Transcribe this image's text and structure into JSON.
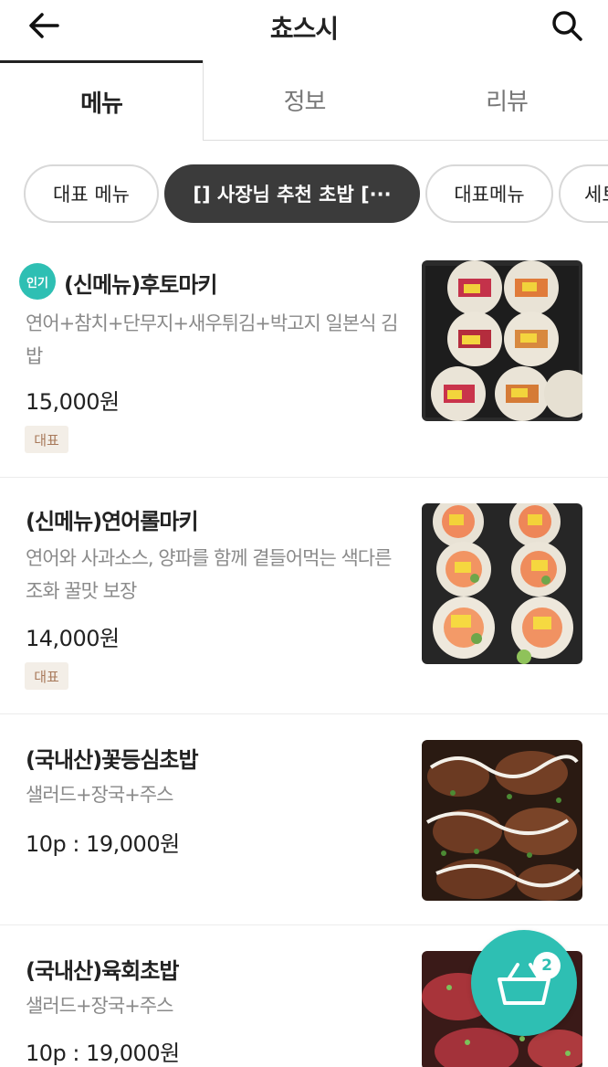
{
  "header": {
    "title": "쵸스시",
    "back_icon": "arrow-left-icon",
    "search_icon": "search-icon"
  },
  "tabs": [
    {
      "label": "메뉴",
      "active": true
    },
    {
      "label": "정보",
      "active": false
    },
    {
      "label": "리뷰",
      "active": false
    }
  ],
  "categories": [
    {
      "label": "대표 메뉴",
      "active": false
    },
    {
      "label": "[] 사장님 추천 초밥 [···",
      "active": true
    },
    {
      "label": "대표메뉴",
      "active": false
    },
    {
      "label": "세트",
      "active": false
    }
  ],
  "menu_items": [
    {
      "popular_badge": "인기",
      "name": "(신메뉴)후토마키",
      "description": "연어+참치+단무지+새우튀김+박고지 일본식 김밥",
      "price": "15,000원",
      "tag": "대표",
      "image": "futomaki-photo"
    },
    {
      "name": "(신메뉴)연어롤마키",
      "description": "연어와 사과소스, 양파를 함께 곁들어먹는 색다른 조화 꿀맛 보장",
      "price": "14,000원",
      "tag": "대표",
      "image": "salmon-roll-photo"
    },
    {
      "name": "(국내산)꽃등심초밥",
      "description": "샐러드+장국+주스",
      "price": "10p : 19,000원",
      "image": "beef-sirloin-sushi-photo"
    },
    {
      "name": "(국내산)육회초밥",
      "description": "샐러드+장국+주스",
      "price": "10p : 19,000원",
      "image": "beef-tartare-sushi-photo"
    }
  ],
  "cart": {
    "icon": "shopping-basket-icon",
    "count": "2"
  },
  "colors": {
    "accent": "#2ebfb3",
    "active_chip": "#3b3b3b",
    "tag_bg": "#f3eee7",
    "tag_text": "#a8795a"
  }
}
